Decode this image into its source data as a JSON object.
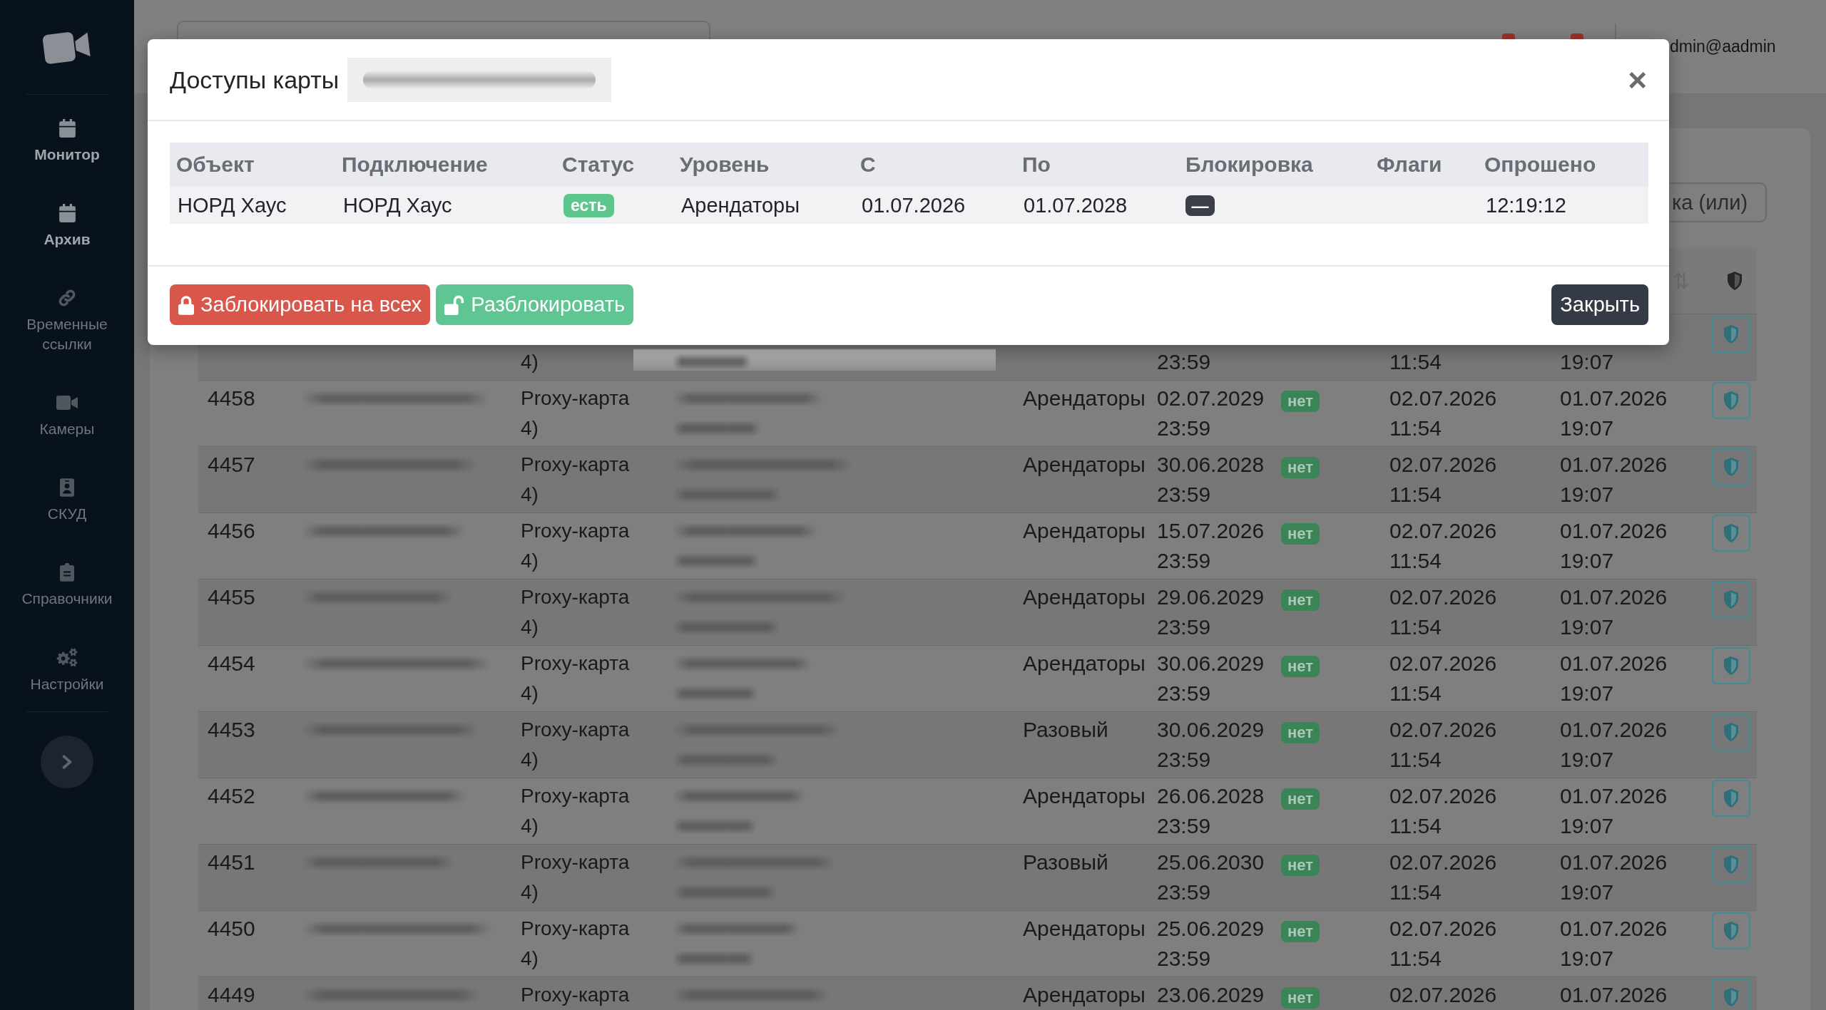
{
  "sidebar": {
    "items": [
      {
        "label": "Монитор",
        "active": true
      },
      {
        "label": "Архив",
        "active": true
      },
      {
        "label": "Временные ссылки",
        "active": false
      },
      {
        "label": "Камеры",
        "active": false
      },
      {
        "label": "СКУД",
        "active": false
      },
      {
        "label": "Справочники",
        "active": false
      },
      {
        "label": "Настройки",
        "active": false
      }
    ]
  },
  "top_bar": {
    "user": "dmin@aadmin"
  },
  "filter": {
    "placeholder": "ка (или)"
  },
  "table": {
    "rows": [
      {
        "column_3": "4)",
        "column_6": "23:59",
        "column_8": "11:54",
        "column_9": "19:07"
      },
      {
        "column_1": "4458",
        "column_3": "Proxy-карта 4)",
        "column_5": "Арендаторы",
        "column_6": "02.07.2029 23:59",
        "column_7": "нет",
        "column_8": "02.07.2026 11:54",
        "column_9": "01.07.2026 19:07"
      },
      {
        "column_1": "4457",
        "column_3": "Proxy-карта 4)",
        "column_5": "Арендаторы",
        "column_6": "30.06.2028 23:59",
        "column_7": "нет",
        "column_8": "02.07.2026 11:54",
        "column_9": "01.07.2026 19:07"
      },
      {
        "column_1": "4456",
        "column_3": "Proxy-карта 4)",
        "column_5": "Арендаторы",
        "column_6": "15.07.2026 23:59",
        "column_7": "нет",
        "column_8": "02.07.2026 11:54",
        "column_9": "01.07.2026 19:07"
      },
      {
        "column_1": "4455",
        "column_3": "Proxy-карта 4)",
        "column_5": "Арендаторы",
        "column_6": "29.06.2029 23:59",
        "column_7": "нет",
        "column_8": "02.07.2026 11:54",
        "column_9": "01.07.2026 19:07"
      },
      {
        "column_1": "4454",
        "column_3": "Proxy-карта 4)",
        "column_5": "Арендаторы",
        "column_6": "30.06.2029 23:59",
        "column_7": "нет",
        "column_8": "02.07.2026 11:54",
        "column_9": "01.07.2026 19:07"
      },
      {
        "column_1": "4453",
        "column_3": "Proxy-карта 4)",
        "column_5": "Разовый",
        "column_6": "30.06.2029 23:59",
        "column_7": "нет",
        "column_8": "02.07.2026 11:54",
        "column_9": "01.07.2026 19:07"
      },
      {
        "column_1": "4452",
        "column_3": "Proxy-карта 4)",
        "column_5": "Арендаторы",
        "column_6": "26.06.2028 23:59",
        "column_7": "нет",
        "column_8": "02.07.2026 11:54",
        "column_9": "01.07.2026 19:07"
      },
      {
        "column_1": "4451",
        "column_3": "Proxy-карта 4)",
        "column_5": "Разовый",
        "column_6": "25.06.2030 23:59",
        "column_7": "нет",
        "column_8": "02.07.2026 11:54",
        "column_9": "01.07.2026 19:07"
      },
      {
        "column_1": "4450",
        "column_3": "Proxy-карта 4)",
        "column_5": "Арендаторы",
        "column_6": "25.06.2029 23:59",
        "column_7": "нет",
        "column_8": "02.07.2026 11:54",
        "column_9": "01.07.2026 19:07"
      },
      {
        "column_1": "4449",
        "column_3": "Proxy-карта",
        "column_5": "Арендаторы",
        "column_6": "23.06.2029",
        "column_7": "нет",
        "column_8": "02.07.2026",
        "column_9": "01.07.2026"
      }
    ]
  },
  "modal": {
    "title": "Доступы карты",
    "close": "×",
    "table": {
      "columns": [
        "Объект",
        "Подключение",
        "Статус",
        "Уровень",
        "С",
        "По",
        "Блокировка",
        "Флаги",
        "Опрошено"
      ],
      "rows": [
        {
          "object": "НОРД Хаус",
          "connection": "НОРД Хаус",
          "status": "есть",
          "access_level": "Арендаторы",
          "from": "01.07.2026",
          "to": "01.07.2028",
          "blocking": "—",
          "polled": "12:19:12"
        }
      ]
    },
    "buttons": [
      {
        "label": "Заблокировать на всех",
        "kind": "danger"
      },
      {
        "label": "Разблокировать",
        "kind": "success"
      },
      {
        "label": "Закрыть",
        "kind": "dark"
      }
    ]
  }
}
